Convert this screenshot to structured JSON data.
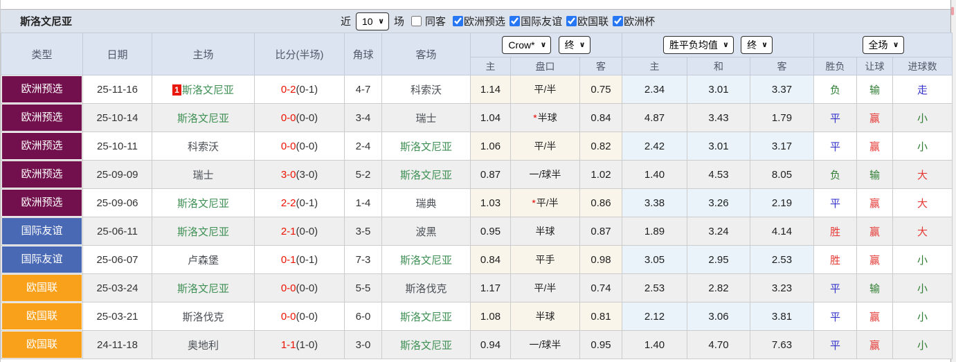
{
  "header": {
    "team": "斯洛文尼亚"
  },
  "toolbar": {
    "recent_label": "近",
    "recent_value": "10",
    "games_label": "场",
    "same_away_label": "同客",
    "same_away_checked": false,
    "filters": [
      {
        "label": "欧洲预选",
        "checked": true
      },
      {
        "label": "国际友谊",
        "checked": true
      },
      {
        "label": "欧国联",
        "checked": true
      },
      {
        "label": "欧洲杯",
        "checked": true
      }
    ]
  },
  "table": {
    "columns": [
      "类型",
      "日期",
      "主场",
      "比分(半场)",
      "角球",
      "客场"
    ],
    "dropdowns": {
      "company": "Crow*",
      "company_stage": "终",
      "average": "胜平负均值",
      "average_stage": "终",
      "scope": "全场"
    },
    "crow_sub": [
      "主",
      "盘口",
      "客"
    ],
    "avg_sub": [
      "主",
      "和",
      "客"
    ],
    "result_sub": [
      "胜负",
      "让球",
      "进球数"
    ],
    "rows": [
      {
        "type": "欧洲预选",
        "type_key": "euq",
        "date": "25-11-16",
        "home_badge": "1",
        "home": "斯洛文尼亚",
        "home_focus": true,
        "score": "0-2",
        "half": "(0-1)",
        "corners": "4-7",
        "away": "科索沃",
        "away_focus": false,
        "odds_home": "1.14",
        "handicap_star": false,
        "handicap": "平/半",
        "odds_away": "0.75",
        "avg_home": "2.34",
        "avg_draw": "3.01",
        "avg_away": "3.37",
        "result": "负",
        "result_color": "green",
        "handicap_result": "输",
        "handicap_result_color": "green",
        "goals": "走",
        "goals_color": "blue"
      },
      {
        "type": "欧洲预选",
        "type_key": "euq",
        "date": "25-10-14",
        "home": "斯洛文尼亚",
        "home_focus": true,
        "score": "0-0",
        "half": "(0-0)",
        "corners": "3-4",
        "away": "瑞士",
        "away_focus": false,
        "odds_home": "1.04",
        "handicap_star": true,
        "handicap": "半球",
        "odds_away": "0.84",
        "avg_home": "4.87",
        "avg_draw": "3.43",
        "avg_away": "1.79",
        "result": "平",
        "result_color": "blue",
        "handicap_result": "赢",
        "handicap_result_color": "red",
        "goals": "小",
        "goals_color": "green"
      },
      {
        "type": "欧洲预选",
        "type_key": "euq",
        "date": "25-10-11",
        "home": "科索沃",
        "home_focus": false,
        "score": "0-0",
        "half": "(0-0)",
        "corners": "2-4",
        "away": "斯洛文尼亚",
        "away_focus": true,
        "odds_home": "1.06",
        "handicap_star": false,
        "handicap": "平/半",
        "odds_away": "0.82",
        "avg_home": "2.42",
        "avg_draw": "3.01",
        "avg_away": "3.17",
        "result": "平",
        "result_color": "blue",
        "handicap_result": "赢",
        "handicap_result_color": "red",
        "goals": "小",
        "goals_color": "green"
      },
      {
        "type": "欧洲预选",
        "type_key": "euq",
        "date": "25-09-09",
        "home": "瑞士",
        "home_focus": false,
        "score": "3-0",
        "half": "(3-0)",
        "corners": "5-2",
        "away": "斯洛文尼亚",
        "away_focus": true,
        "odds_home": "0.87",
        "handicap_star": false,
        "handicap": "一/球半",
        "odds_away": "1.02",
        "avg_home": "1.40",
        "avg_draw": "4.53",
        "avg_away": "8.05",
        "result": "负",
        "result_color": "green",
        "handicap_result": "输",
        "handicap_result_color": "green",
        "goals": "大",
        "goals_color": "red"
      },
      {
        "type": "欧洲预选",
        "type_key": "euq",
        "date": "25-09-06",
        "home": "斯洛文尼亚",
        "home_focus": true,
        "score": "2-2",
        "half": "(0-1)",
        "corners": "1-4",
        "away": "瑞典",
        "away_focus": false,
        "odds_home": "1.03",
        "handicap_star": true,
        "handicap": "平/半",
        "odds_away": "0.86",
        "avg_home": "3.38",
        "avg_draw": "3.26",
        "avg_away": "2.19",
        "result": "平",
        "result_color": "blue",
        "handicap_result": "赢",
        "handicap_result_color": "red",
        "goals": "大",
        "goals_color": "red"
      },
      {
        "type": "国际友谊",
        "type_key": "friendly",
        "date": "25-06-11",
        "home": "斯洛文尼亚",
        "home_focus": true,
        "score": "2-1",
        "half": "(0-0)",
        "corners": "3-5",
        "away": "波黑",
        "away_focus": false,
        "odds_home": "0.95",
        "handicap_star": false,
        "handicap": "半球",
        "odds_away": "0.87",
        "avg_home": "1.89",
        "avg_draw": "3.24",
        "avg_away": "4.14",
        "result": "胜",
        "result_color": "red",
        "handicap_result": "赢",
        "handicap_result_color": "red",
        "goals": "大",
        "goals_color": "red"
      },
      {
        "type": "国际友谊",
        "type_key": "friendly",
        "date": "25-06-07",
        "home": "卢森堡",
        "home_focus": false,
        "score": "0-1",
        "half": "(0-1)",
        "corners": "7-3",
        "away": "斯洛文尼亚",
        "away_focus": true,
        "odds_home": "0.84",
        "handicap_star": false,
        "handicap": "平手",
        "odds_away": "0.98",
        "avg_home": "3.05",
        "avg_draw": "2.95",
        "avg_away": "2.53",
        "result": "胜",
        "result_color": "red",
        "handicap_result": "赢",
        "handicap_result_color": "red",
        "goals": "小",
        "goals_color": "green"
      },
      {
        "type": "欧国联",
        "type_key": "unl",
        "date": "25-03-24",
        "home": "斯洛文尼亚",
        "home_focus": true,
        "score": "0-0",
        "half": "(0-0)",
        "corners": "5-5",
        "away": "斯洛伐克",
        "away_focus": false,
        "odds_home": "1.17",
        "handicap_star": false,
        "handicap": "平/半",
        "odds_away": "0.74",
        "avg_home": "2.53",
        "avg_draw": "2.82",
        "avg_away": "3.23",
        "result": "平",
        "result_color": "blue",
        "handicap_result": "输",
        "handicap_result_color": "green",
        "goals": "小",
        "goals_color": "green"
      },
      {
        "type": "欧国联",
        "type_key": "unl",
        "date": "25-03-21",
        "home": "斯洛伐克",
        "home_focus": false,
        "score": "0-0",
        "half": "(0-0)",
        "corners": "6-0",
        "away": "斯洛文尼亚",
        "away_focus": true,
        "odds_home": "1.08",
        "handicap_star": false,
        "handicap": "半球",
        "odds_away": "0.81",
        "avg_home": "2.12",
        "avg_draw": "3.06",
        "avg_away": "3.81",
        "result": "平",
        "result_color": "blue",
        "handicap_result": "赢",
        "handicap_result_color": "red",
        "goals": "小",
        "goals_color": "green"
      },
      {
        "type": "欧国联",
        "type_key": "unl",
        "date": "24-11-18",
        "home": "奥地利",
        "home_focus": false,
        "score": "1-1",
        "half": "(1-0)",
        "corners": "3-0",
        "away": "斯洛文尼亚",
        "away_focus": true,
        "odds_home": "0.94",
        "handicap_star": false,
        "handicap": "一/球半",
        "odds_away": "0.95",
        "avg_home": "1.40",
        "avg_draw": "4.70",
        "avg_away": "7.63",
        "result": "平",
        "result_color": "blue",
        "handicap_result": "赢",
        "handicap_result_color": "red",
        "goals": "小",
        "goals_color": "green"
      }
    ]
  },
  "colors": {
    "type_euq": "#72104d",
    "type_friendly": "#4a69b5",
    "type_unl": "#f9a11b",
    "focus_team": "#3f9054",
    "team_text": "#4a4f55",
    "score_red": "#ee1100",
    "result_red": "#e53935",
    "result_green": "#2f7d32",
    "result_blue": "#3333cc",
    "odds_bg": "#faf5ea",
    "avg_bg": "#e9f3f9",
    "header_bg": "#dbe4f0",
    "toolbar_bg": "#dde3ec",
    "stripe_bg": "#efefef",
    "badge_red": "#e8180c",
    "checkbox_accent": "#2776f4"
  }
}
